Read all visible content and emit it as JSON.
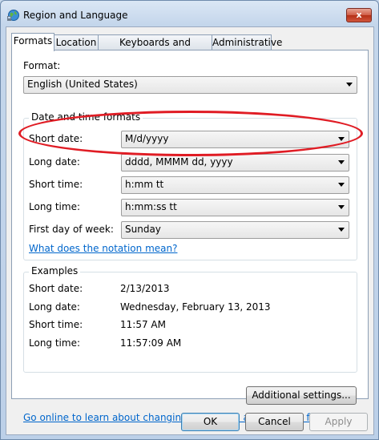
{
  "window": {
    "title": "Region and Language",
    "close_label": "x"
  },
  "tabs": [
    {
      "label": "Formats"
    },
    {
      "label": "Location"
    },
    {
      "label": "Keyboards and Languages"
    },
    {
      "label": "Administrative"
    }
  ],
  "format": {
    "label": "Format:",
    "value": "English (United States)"
  },
  "date_time_formats": {
    "title": "Date and time formats",
    "short_date": {
      "label": "Short date:",
      "value": "M/d/yyyy"
    },
    "long_date": {
      "label": "Long date:",
      "value": "dddd, MMMM dd, yyyy"
    },
    "short_time": {
      "label": "Short time:",
      "value": "h:mm tt"
    },
    "long_time": {
      "label": "Long time:",
      "value": "h:mm:ss tt"
    },
    "first_day": {
      "label": "First day of week:",
      "value": "Sunday"
    },
    "notation_link": "What does the notation mean?"
  },
  "examples": {
    "title": "Examples",
    "short_date": {
      "label": "Short date:",
      "value": "2/13/2013"
    },
    "long_date": {
      "label": "Long date:",
      "value": "Wednesday, February 13, 2013"
    },
    "short_time": {
      "label": "Short time:",
      "value": "11:57 AM"
    },
    "long_time": {
      "label": "Long time:",
      "value": "11:57:09 AM"
    }
  },
  "additional_settings": "Additional settings...",
  "online_link": "Go online to learn about changing languages and regional formats",
  "buttons": {
    "ok": "OK",
    "cancel": "Cancel",
    "apply": "Apply"
  },
  "colors": {
    "highlight": "#e01c24",
    "link": "#0066cc"
  }
}
